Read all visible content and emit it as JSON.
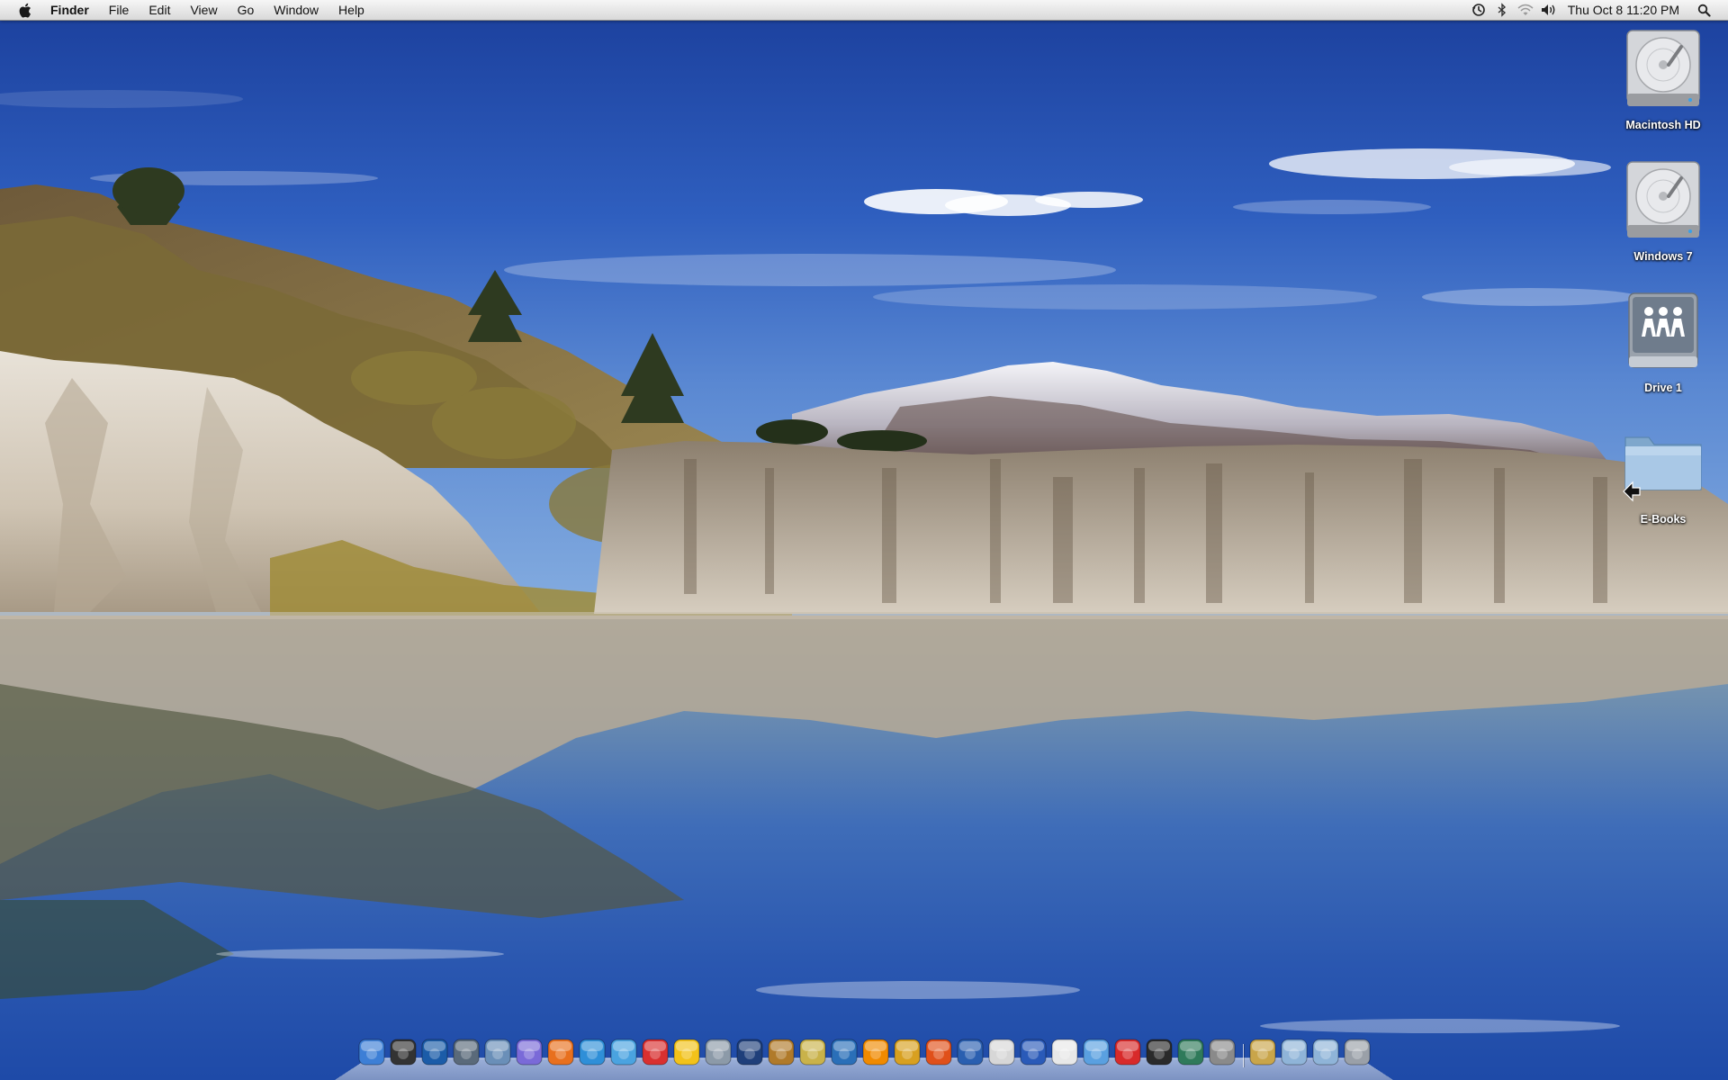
{
  "menubar": {
    "apple_icon": "apple-logo-icon",
    "app_name": "Finder",
    "menus": [
      "File",
      "Edit",
      "View",
      "Go",
      "Window",
      "Help"
    ],
    "status_icons": [
      "time-machine-icon",
      "bluetooth-icon",
      "wifi-icon",
      "volume-icon"
    ],
    "clock": "Thu Oct 8  11:20 PM",
    "spotlight_icon": "spotlight-search-icon"
  },
  "desktop": {
    "wallpaper": "lake-with-white-cliffs-and-snowy-mountain",
    "icons": [
      {
        "label": "Macintosh HD",
        "icon": "hard-drive-icon"
      },
      {
        "label": "Windows 7",
        "icon": "hard-drive-icon"
      },
      {
        "label": "Drive 1",
        "icon": "network-share-icon"
      },
      {
        "label": "E-Books",
        "icon": "folder-alias-icon"
      }
    ]
  },
  "dock": {
    "apps": [
      {
        "icon": "finder-icon",
        "color": "#3d7fd6"
      },
      {
        "icon": "dashboard-icon",
        "color": "#333333"
      },
      {
        "icon": "kc-icon",
        "color": "#1b5ca8"
      },
      {
        "icon": "spaces-icon",
        "color": "#5a6a7a"
      },
      {
        "icon": "preview-icon",
        "color": "#6a8fb8"
      },
      {
        "icon": "web-app-icon",
        "color": "#7a6ad8"
      },
      {
        "icon": "firefox-icon",
        "color": "#e8701e"
      },
      {
        "icon": "safari-icon",
        "color": "#2f8fd8"
      },
      {
        "icon": "itunes-icon",
        "color": "#4aa3e0"
      },
      {
        "icon": "ical-icon",
        "color": "#d93030"
      },
      {
        "icon": "adium-icon",
        "color": "#f2c21a"
      },
      {
        "icon": "iphoto-icon",
        "color": "#8c9aa8"
      },
      {
        "icon": "photoshop-icon",
        "color": "#1f3f7a"
      },
      {
        "icon": "image-capture-icon",
        "color": "#b07a2a"
      },
      {
        "icon": "imovie-icon",
        "color": "#c9b24a"
      },
      {
        "icon": "quicktime-icon",
        "color": "#2a6fb8"
      },
      {
        "icon": "vlc-icon",
        "color": "#f08a00"
      },
      {
        "icon": "pineapple-app-icon",
        "color": "#d8a020"
      },
      {
        "icon": "burn-app-icon",
        "color": "#e0501a"
      },
      {
        "icon": "network-globe-icon",
        "color": "#2a5fb0"
      },
      {
        "icon": "textedit-icon",
        "color": "#d7d7d7"
      },
      {
        "icon": "cyberduck-icon",
        "color": "#2a5ab8"
      },
      {
        "icon": "script-editor-icon",
        "color": "#e8e8e8"
      },
      {
        "icon": "word-app-icon",
        "color": "#5aa0e0"
      },
      {
        "icon": "vnc-icon",
        "color": "#d82a2a"
      },
      {
        "icon": "terminal-icon",
        "color": "#2a2a2a"
      },
      {
        "icon": "time-machine-icon",
        "color": "#2f7a5a"
      },
      {
        "icon": "system-preferences-icon",
        "color": "#8a8a8a"
      }
    ],
    "stacks": [
      {
        "icon": "documents-stack-icon",
        "color": "#c9a54a"
      },
      {
        "icon": "downloads-stack-icon",
        "color": "#8fb4d8"
      },
      {
        "icon": "applications-stack-icon",
        "color": "#8fb4d8"
      },
      {
        "icon": "trash-icon",
        "color": "#9aa0a8"
      }
    ]
  }
}
